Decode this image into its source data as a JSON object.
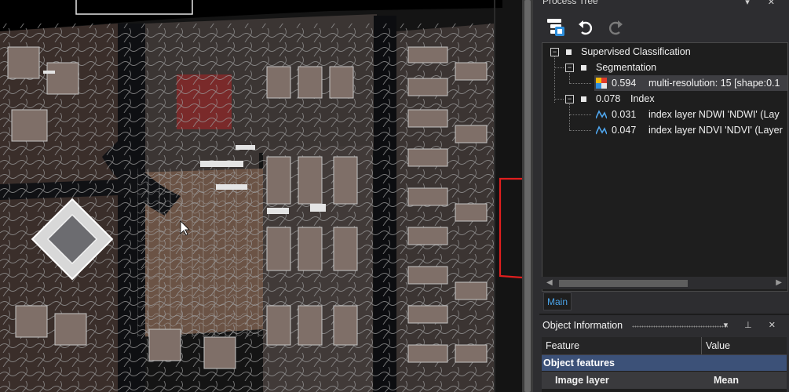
{
  "process_tree": {
    "title": "Process Tree",
    "nodes": [
      {
        "label": "Supervised Classification"
      },
      {
        "label": "Segmentation"
      },
      {
        "time": "0.594",
        "label": "multi-resolution: 15 [shape:0.1"
      },
      {
        "time": "0.078",
        "label": "Index"
      },
      {
        "time": "0.031",
        "label": "index layer NDWI 'NDWI' (Lay"
      },
      {
        "time": "0.047",
        "label": "index layer NDVI 'NDVI' (Layer"
      }
    ],
    "tabs": [
      {
        "label": "Main"
      }
    ]
  },
  "object_information": {
    "title": "Object Information",
    "columns": [
      "Feature",
      "Value"
    ],
    "group": "Object features",
    "row": {
      "feature": "Image layer",
      "value": "Mean"
    }
  },
  "colors": {
    "accent_tab": "#4aa3e8",
    "group_row": "#3c5178",
    "selection_outline": "#e01e1e",
    "segment_outline": "#b8b8b8"
  }
}
